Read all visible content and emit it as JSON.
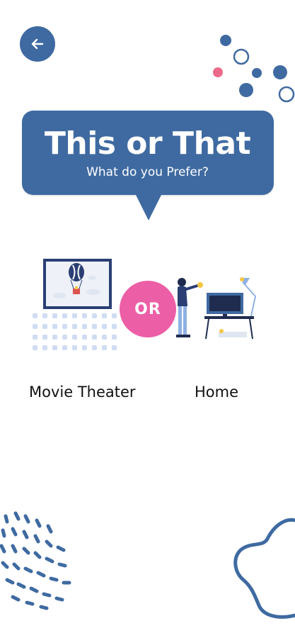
{
  "header": {
    "back_icon": "arrow-left-icon"
  },
  "bubble": {
    "title": "This or That",
    "subtitle": "What do you Prefer?"
  },
  "choices": {
    "separator": "OR",
    "left_label": "Movie Theater",
    "right_label": "Home"
  },
  "colors": {
    "primary": "#3f6aa1",
    "accent_pink": "#ec5ea6",
    "light_blue": "#cfdcf3",
    "yellow": "#f5c642"
  }
}
